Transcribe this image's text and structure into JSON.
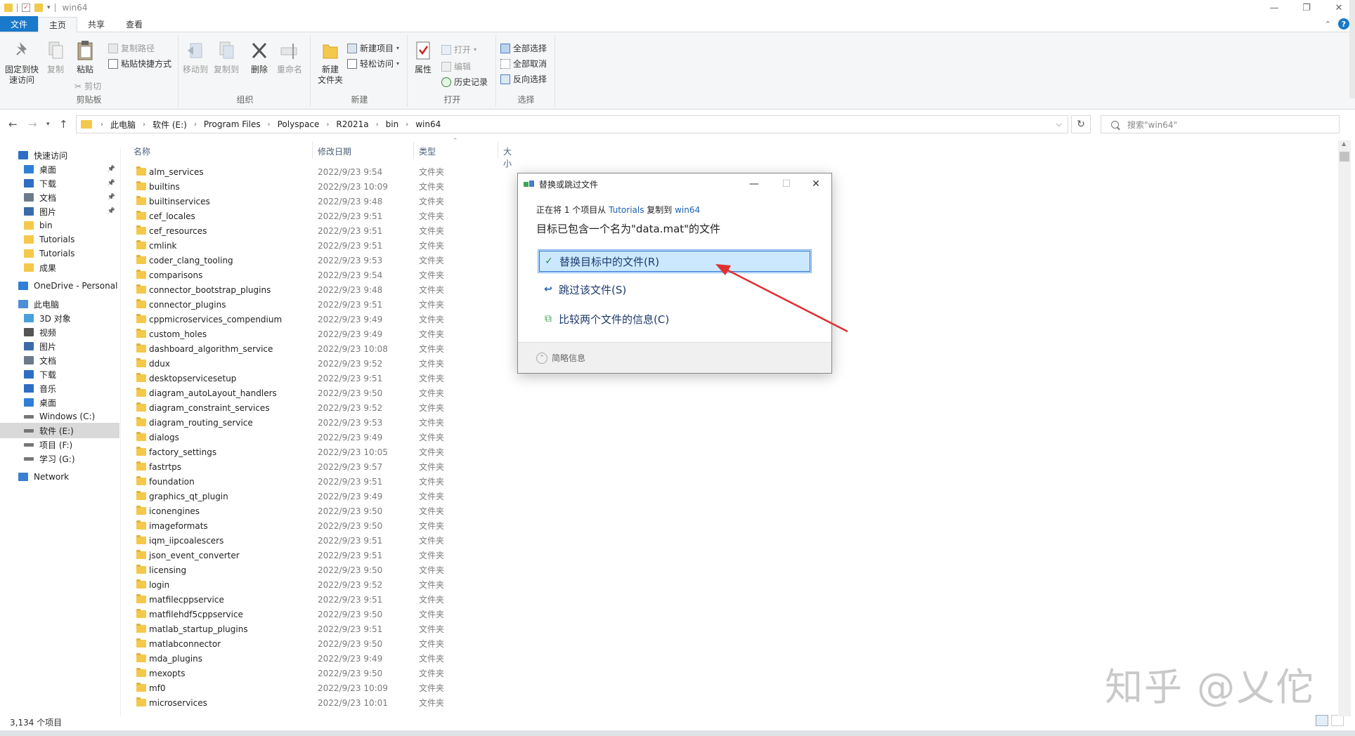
{
  "window": {
    "title": "win64",
    "controls": {
      "minimize": "—",
      "restore": "❐",
      "close": "✕"
    }
  },
  "ribbon": {
    "tabs": [
      {
        "label": "文件"
      },
      {
        "label": "主页"
      },
      {
        "label": "共享"
      },
      {
        "label": "查看"
      }
    ],
    "clipboard": {
      "group_label": "剪贴板",
      "pin_quick_access": "固定到快\n速访问",
      "copy": "复制",
      "paste": "粘贴",
      "copy_path": "复制路径",
      "paste_shortcut": "粘贴快捷方式",
      "cut": "剪切"
    },
    "organize": {
      "group_label": "组织",
      "move_to": "移动到",
      "copy_to": "复制到",
      "delete": "删除",
      "rename": "重命名"
    },
    "new": {
      "group_label": "新建",
      "new_folder": "新建\n文件夹",
      "new_item": "新建项目",
      "easy_access": "轻松访问"
    },
    "open": {
      "group_label": "打开",
      "properties": "属性",
      "open": "打开",
      "edit": "编辑",
      "history": "历史记录"
    },
    "select": {
      "group_label": "选择",
      "select_all": "全部选择",
      "select_none": "全部取消",
      "invert": "反向选择"
    }
  },
  "address_bar": {
    "crumbs": [
      "此电脑",
      "软件 (E:)",
      "Program Files",
      "Polyspace",
      "R2021a",
      "bin",
      "win64"
    ],
    "search_placeholder": "搜索\"win64\""
  },
  "nav_pane": {
    "items": [
      {
        "label": "快速访问",
        "icon": "star-icon",
        "level": 0
      },
      {
        "label": "桌面",
        "icon": "desktop-icon",
        "level": 1,
        "pinned": true
      },
      {
        "label": "下载",
        "icon": "download-icon",
        "level": 1,
        "pinned": true
      },
      {
        "label": "文档",
        "icon": "document-icon",
        "level": 1,
        "pinned": true
      },
      {
        "label": "图片",
        "icon": "picture-icon",
        "level": 1,
        "pinned": true
      },
      {
        "label": "bin",
        "icon": "folder-icon",
        "level": 1
      },
      {
        "label": "Tutorials",
        "icon": "folder-icon",
        "level": 1
      },
      {
        "label": "Tutorials",
        "icon": "folder-icon",
        "level": 1
      },
      {
        "label": "成果",
        "icon": "folder-icon",
        "level": 1
      },
      {
        "label": "OneDrive - Personal",
        "icon": "cloud-icon",
        "level": 0
      },
      {
        "label": "此电脑",
        "icon": "computer-icon",
        "level": 0
      },
      {
        "label": "3D 对象",
        "icon": "cube-icon",
        "level": 1
      },
      {
        "label": "视频",
        "icon": "video-icon",
        "level": 1
      },
      {
        "label": "图片",
        "icon": "picture-icon",
        "level": 1
      },
      {
        "label": "文档",
        "icon": "document-icon",
        "level": 1
      },
      {
        "label": "下载",
        "icon": "download-icon",
        "level": 1
      },
      {
        "label": "音乐",
        "icon": "music-icon",
        "level": 1
      },
      {
        "label": "桌面",
        "icon": "desktop-icon",
        "level": 1
      },
      {
        "label": "Windows (C:)",
        "icon": "drive-icon",
        "level": 1
      },
      {
        "label": "软件 (E:)",
        "icon": "drive-icon",
        "level": 1,
        "selected": true
      },
      {
        "label": "项目 (F:)",
        "icon": "drive-icon",
        "level": 1
      },
      {
        "label": "学习 (G:)",
        "icon": "drive-icon",
        "level": 1
      },
      {
        "label": "Network",
        "icon": "network-icon",
        "level": 0
      }
    ]
  },
  "file_list": {
    "columns": {
      "name": "名称",
      "date": "修改日期",
      "type": "类型",
      "size": "大小"
    },
    "rows": [
      {
        "name": "alm_services",
        "date": "2022/9/23 9:54",
        "type": "文件夹"
      },
      {
        "name": "builtins",
        "date": "2022/9/23 10:09",
        "type": "文件夹"
      },
      {
        "name": "builtinservices",
        "date": "2022/9/23 9:48",
        "type": "文件夹"
      },
      {
        "name": "cef_locales",
        "date": "2022/9/23 9:51",
        "type": "文件夹"
      },
      {
        "name": "cef_resources",
        "date": "2022/9/23 9:51",
        "type": "文件夹"
      },
      {
        "name": "cmlink",
        "date": "2022/9/23 9:51",
        "type": "文件夹"
      },
      {
        "name": "coder_clang_tooling",
        "date": "2022/9/23 9:53",
        "type": "文件夹"
      },
      {
        "name": "comparisons",
        "date": "2022/9/23 9:54",
        "type": "文件夹"
      },
      {
        "name": "connector_bootstrap_plugins",
        "date": "2022/9/23 9:48",
        "type": "文件夹"
      },
      {
        "name": "connector_plugins",
        "date": "2022/9/23 9:51",
        "type": "文件夹"
      },
      {
        "name": "cppmicroservices_compendium",
        "date": "2022/9/23 9:49",
        "type": "文件夹"
      },
      {
        "name": "custom_holes",
        "date": "2022/9/23 9:49",
        "type": "文件夹"
      },
      {
        "name": "dashboard_algorithm_service",
        "date": "2022/9/23 10:08",
        "type": "文件夹"
      },
      {
        "name": "ddux",
        "date": "2022/9/23 9:52",
        "type": "文件夹"
      },
      {
        "name": "desktopservicesetup",
        "date": "2022/9/23 9:51",
        "type": "文件夹"
      },
      {
        "name": "diagram_autoLayout_handlers",
        "date": "2022/9/23 9:50",
        "type": "文件夹"
      },
      {
        "name": "diagram_constraint_services",
        "date": "2022/9/23 9:52",
        "type": "文件夹"
      },
      {
        "name": "diagram_routing_service",
        "date": "2022/9/23 9:53",
        "type": "文件夹"
      },
      {
        "name": "dialogs",
        "date": "2022/9/23 9:49",
        "type": "文件夹"
      },
      {
        "name": "factory_settings",
        "date": "2022/9/23 10:05",
        "type": "文件夹"
      },
      {
        "name": "fastrtps",
        "date": "2022/9/23 9:57",
        "type": "文件夹"
      },
      {
        "name": "foundation",
        "date": "2022/9/23 9:51",
        "type": "文件夹"
      },
      {
        "name": "graphics_qt_plugin",
        "date": "2022/9/23 9:49",
        "type": "文件夹"
      },
      {
        "name": "iconengines",
        "date": "2022/9/23 9:50",
        "type": "文件夹"
      },
      {
        "name": "imageformats",
        "date": "2022/9/23 9:50",
        "type": "文件夹"
      },
      {
        "name": "iqm_iipcoalescers",
        "date": "2022/9/23 9:51",
        "type": "文件夹"
      },
      {
        "name": "json_event_converter",
        "date": "2022/9/23 9:51",
        "type": "文件夹"
      },
      {
        "name": "licensing",
        "date": "2022/9/23 9:50",
        "type": "文件夹"
      },
      {
        "name": "login",
        "date": "2022/9/23 9:52",
        "type": "文件夹"
      },
      {
        "name": "matfilecppservice",
        "date": "2022/9/23 9:51",
        "type": "文件夹"
      },
      {
        "name": "matfilehdf5cppservice",
        "date": "2022/9/23 9:50",
        "type": "文件夹"
      },
      {
        "name": "matlab_startup_plugins",
        "date": "2022/9/23 9:51",
        "type": "文件夹"
      },
      {
        "name": "matlabconnector",
        "date": "2022/9/23 9:50",
        "type": "文件夹"
      },
      {
        "name": "mda_plugins",
        "date": "2022/9/23 9:49",
        "type": "文件夹"
      },
      {
        "name": "mexopts",
        "date": "2022/9/23 9:50",
        "type": "文件夹"
      },
      {
        "name": "mf0",
        "date": "2022/9/23 10:09",
        "type": "文件夹"
      },
      {
        "name": "microservices",
        "date": "2022/9/23 10:01",
        "type": "文件夹"
      }
    ]
  },
  "status_bar": {
    "item_count": "3,134 个项目"
  },
  "dialog": {
    "title": "替换或跳过文件",
    "progress_prefix": "正在将 1 个项目从 ",
    "source": "Tutorials",
    "progress_mid": " 复制到 ",
    "dest": "win64",
    "message": "目标已包含一个名为\"data.mat\"的文件",
    "options": [
      {
        "label": "替换目标中的文件(R)",
        "icon": "check-icon",
        "selected": true
      },
      {
        "label": "跳过该文件(S)",
        "icon": "skip-icon",
        "selected": false
      },
      {
        "label": "比较两个文件的信息(C)",
        "icon": "compare-icon",
        "selected": false
      }
    ],
    "more_details": "简略信息"
  },
  "watermark": "知乎 @乂佗",
  "colors": {
    "accent": "#1979ca",
    "folder": "#f4c84a",
    "selection": "#cce8ff",
    "arrow": "#e03030"
  }
}
